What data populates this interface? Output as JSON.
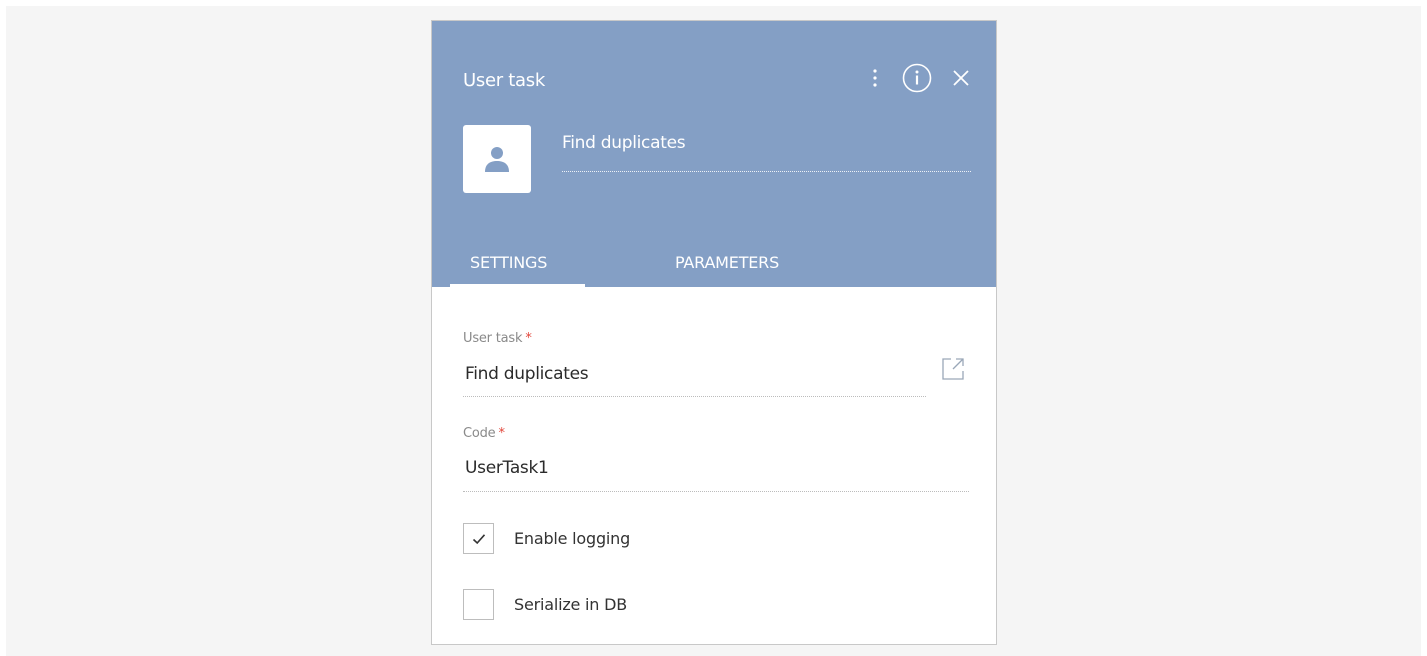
{
  "panel": {
    "title": "User task",
    "name": "Find duplicates",
    "header_color": "#849fc5",
    "accent_required_color": "#e2463b"
  },
  "header_actions": {
    "more_icon": "vertical-ellipsis-icon",
    "info_icon": "info-circle-icon",
    "close_icon": "close-icon"
  },
  "tabs": [
    {
      "label": "SETTINGS",
      "active": true
    },
    {
      "label": "PARAMETERS",
      "active": false
    }
  ],
  "settings": {
    "user_task": {
      "label": "User task",
      "required_mark": "*",
      "value": "Find duplicates",
      "action_icon": "open-in-new-icon"
    },
    "code": {
      "label": "Code",
      "required_mark": "*",
      "value": "UserTask1"
    },
    "enable_logging": {
      "label": "Enable logging",
      "checked": true
    },
    "serialize_in_db": {
      "label": "Serialize in DB",
      "checked": false
    }
  }
}
